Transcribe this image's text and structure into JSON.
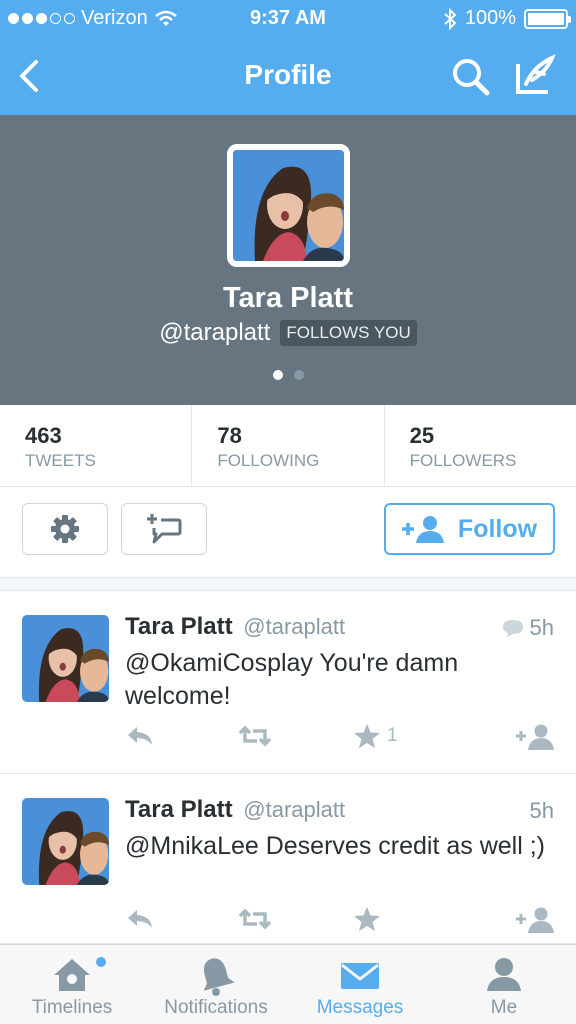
{
  "status_bar": {
    "carrier": "Verizon",
    "time": "9:37 AM",
    "battery": "100%"
  },
  "nav": {
    "title": "Profile"
  },
  "profile": {
    "name": "Tara Platt",
    "handle": "@taraplatt",
    "follows_badge": "FOLLOWS YOU"
  },
  "stats": [
    {
      "num": "463",
      "label": "TWEETS"
    },
    {
      "num": "78",
      "label": "FOLLOWING"
    },
    {
      "num": "25",
      "label": "FOLLOWERS"
    }
  ],
  "actions": {
    "follow_label": "Follow"
  },
  "tweets": [
    {
      "name": "Tara Platt",
      "handle": "@taraplatt",
      "time": "5h",
      "text": "@OkamiCosplay You're damn welcome!",
      "fav_count": "1"
    },
    {
      "name": "Tara Platt",
      "handle": "@taraplatt",
      "time": "5h",
      "text": "@MnikaLee Deserves credit as well ;)",
      "fav_count": ""
    }
  ],
  "tabs": [
    {
      "label": "Timelines"
    },
    {
      "label": "Notifications"
    },
    {
      "label": "Messages"
    },
    {
      "label": "Me"
    }
  ],
  "colors": {
    "accent": "#55acee",
    "header_bg": "#66757f",
    "muted": "#8899a6"
  }
}
